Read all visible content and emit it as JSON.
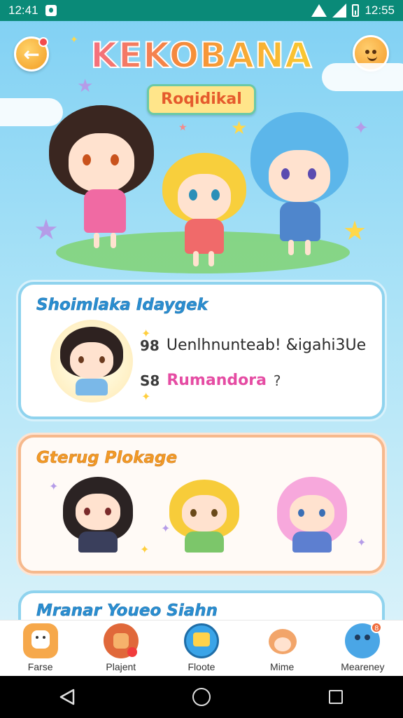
{
  "status_bar": {
    "time_left": "12:41",
    "time_right": "12:55"
  },
  "header": {
    "title": "KEKOBANA",
    "subtitle": "Roqidikal"
  },
  "cards": {
    "profile": {
      "title": "Shoimlaka Idaygek",
      "rows": [
        {
          "num": "98",
          "text": "Uenlhnunteab! &igahi3Ue"
        },
        {
          "num": "S8",
          "text": "Rumandora",
          "suffix": "?"
        }
      ]
    },
    "gallery": {
      "title": "Gterug Plokage"
    },
    "partial": {
      "title": "Mranar Youeo Siahn"
    }
  },
  "bottom_nav": {
    "items": [
      {
        "label": "Farse",
        "icon": "scroll-character-icon",
        "color": "#f6a84b"
      },
      {
        "label": "Plajent",
        "icon": "bag-icon",
        "color": "#e0683a"
      },
      {
        "label": "Floote",
        "icon": "chat-bubble-icon",
        "color": "#3aa4e8"
      },
      {
        "label": "Mime",
        "icon": "cat-face-icon",
        "color": "#f2a56a"
      },
      {
        "label": "Meareney",
        "icon": "bird-chat-icon",
        "color": "#4aa6e6",
        "badge": "8"
      }
    ]
  },
  "colors": {
    "status_bar": "#0a8a78",
    "card_blue_border": "#8fd3ee",
    "card_orange_border": "#f6b98d",
    "title_pink": "#f255c8",
    "title_orange": "#f58a3a"
  }
}
